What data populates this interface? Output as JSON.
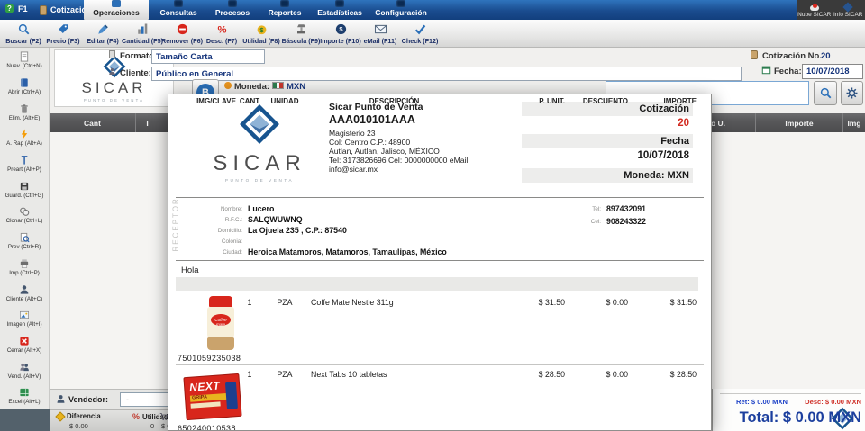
{
  "titlebar": {
    "help_label": "F1",
    "tab_label": "Cotización",
    "menus": [
      {
        "label": "Operaciones"
      },
      {
        "label": "Consultas"
      },
      {
        "label": "Procesos"
      },
      {
        "label": "Reportes"
      },
      {
        "label": "Estadísticas"
      },
      {
        "label": "Configuración"
      }
    ],
    "right": [
      {
        "label": "Nube SICAR",
        "icon": "cloud-icon"
      },
      {
        "label": "Info SICAR",
        "icon": "sicar-diamond-icon"
      }
    ]
  },
  "toolbar": {
    "items": [
      {
        "label": "Buscar (F2)",
        "icon": "search-icon"
      },
      {
        "label": "Precio (F3)",
        "icon": "price-tag-icon"
      },
      {
        "label": "Editar (F4)",
        "icon": "pencil-icon"
      },
      {
        "label": "Cantidad (F5)",
        "icon": "quantity-icon"
      },
      {
        "label": "Remover (F6)",
        "icon": "remove-icon"
      },
      {
        "label": "Desc. (F7)",
        "icon": "discount-icon"
      },
      {
        "label": "Utilidad (F8)",
        "icon": "profit-icon"
      },
      {
        "label": "Báscula (F9)",
        "icon": "scale-icon"
      },
      {
        "label": "Importe (F10)",
        "icon": "amount-icon"
      },
      {
        "label": "eMail (F11)",
        "icon": "email-icon"
      },
      {
        "label": "Check (F12)",
        "icon": "check-icon"
      }
    ]
  },
  "sidebar": {
    "items": [
      {
        "label": "Nuev. (Ctrl+N)",
        "icon": "new-document-icon"
      },
      {
        "label": "Abrir (Ctrl+A)",
        "icon": "open-book-icon"
      },
      {
        "label": "Elim. (Alt+E)",
        "icon": "trash-icon"
      },
      {
        "label": "A. Rap (Alt+A)",
        "icon": "lightning-icon"
      },
      {
        "label": "Preart (Alt+P)",
        "icon": "pin-icon"
      },
      {
        "label": "Guard. (Ctrl+G)",
        "icon": "save-floppy-icon"
      },
      {
        "label": "Clonar (Ctrl+L)",
        "icon": "clone-icon"
      },
      {
        "label": "Prev (Ctrl+R)",
        "icon": "preview-icon"
      },
      {
        "label": "Imp (Ctrl+P)",
        "icon": "printer-icon"
      },
      {
        "label": "Cliente (Alt+C)",
        "icon": "client-icon"
      },
      {
        "label": "Imagen (Alt+I)",
        "icon": "image-icon"
      },
      {
        "label": "Cerrar (Alt+X)",
        "icon": "close-icon"
      },
      {
        "label": "Vend. (Alt+V)",
        "icon": "vendors-icon"
      },
      {
        "label": "Excel (Alt+L)",
        "icon": "excel-icon"
      }
    ]
  },
  "form": {
    "formato_label": "Formato:",
    "formato_value": "Tamaño Carta",
    "cliente_label": "Cliente:",
    "cliente_value": "Público en General",
    "cotizacion_no_label": "Cotización No.",
    "cotizacion_no_value": "20",
    "fecha_label": "Fecha:",
    "fecha_value": "10/07/2018",
    "moneda_label": "Moneda:",
    "moneda_value": "MXN",
    "b_button_label": "B",
    "brand": "SICAR",
    "brand_sub": "PUNTO DE VENTA"
  },
  "grid": {
    "columns": [
      "Cant",
      "I",
      "",
      "o U.",
      "Importe",
      "Img"
    ]
  },
  "document": {
    "company": {
      "name": "Sicar Punto de Venta",
      "rfc": "AAA010101AAA",
      "address_lines": [
        "Magisterio 23",
        "Col: Centro C.P.: 48900",
        "Autlan, Autlan, Jalisco, MÉXICO",
        "Tel: 3173826696 Cel: 0000000000 eMail:",
        "info@sicar.mx"
      ],
      "brand": "SICAR",
      "brand_sub": "PUNTO DE VENTA"
    },
    "meta": {
      "cotizacion_label": "Cotización",
      "cotizacion_value": "20",
      "fecha_label": "Fecha",
      "fecha_value": "10/07/2018",
      "moneda": "Moneda: MXN"
    },
    "receptor": {
      "section_label": "RECEPTOR",
      "rows": [
        {
          "label": "Nombre:",
          "value": "Lucero"
        },
        {
          "label": "R.F.C.:",
          "value": "SALQWUWNQ"
        },
        {
          "label": "Domicilio:",
          "value": "La Ojuela 235 , C.P.: 87540"
        },
        {
          "label": "Colonia:",
          "value": ""
        },
        {
          "label": "Ciudad:",
          "value": "Heroica Matamoros, Matamoros, Tamaulipas, México"
        }
      ],
      "tel_label": "Tel:",
      "tel_value": "897432091",
      "cel_label": "Cel:",
      "cel_value": "908243322"
    },
    "note": "Hola",
    "table": {
      "headers": [
        "IMG/CLAVE",
        "CANT",
        "UNIDAD",
        "DESCRIPCIÓN",
        "P. UNIT.",
        "DESCUENTO",
        "IMPORTE"
      ],
      "rows": [
        {
          "cant": "1",
          "unidad": "PZA",
          "descripcion": "Coffe Mate Nestle 311g",
          "p_unit": "$ 31.50",
          "descuento": "$ 0.00",
          "importe": "$ 31.50",
          "clave": "7501059235038",
          "img": "coffee-mate-product"
        },
        {
          "cant": "1",
          "unidad": "PZA",
          "descripcion": "Next Tabs 10 tabletas",
          "p_unit": "$ 28.50",
          "descuento": "$ 0.00",
          "importe": "$ 28.50",
          "clave": "650240010538",
          "img": "next-tabs-product"
        }
      ]
    },
    "product_art": {
      "coffee_label": "Coffee mate",
      "next_word": "NEXT",
      "next_strip": "GRIPA"
    }
  },
  "vendedor": {
    "label": "Vendedor:",
    "value": "-"
  },
  "status": {
    "diferencia_label": "Diferencia",
    "diferencia_value": "$ 0.00",
    "utilidad_label": "Utilidad",
    "utilidad_value": "0",
    "cart_value": "$ 0",
    "ret": "Ret: $ 0.00 MXN",
    "desc": "Desc: $ 0.00 MXN",
    "total": "Total: $ 0.00 MXN"
  },
  "colors": {
    "accent": "#2a6fb8",
    "titlebar_top": "#2f74bd",
    "titlebar_bottom": "#123f7d",
    "alert_red": "#d8261c",
    "total_navy": "#1c3f9e"
  }
}
